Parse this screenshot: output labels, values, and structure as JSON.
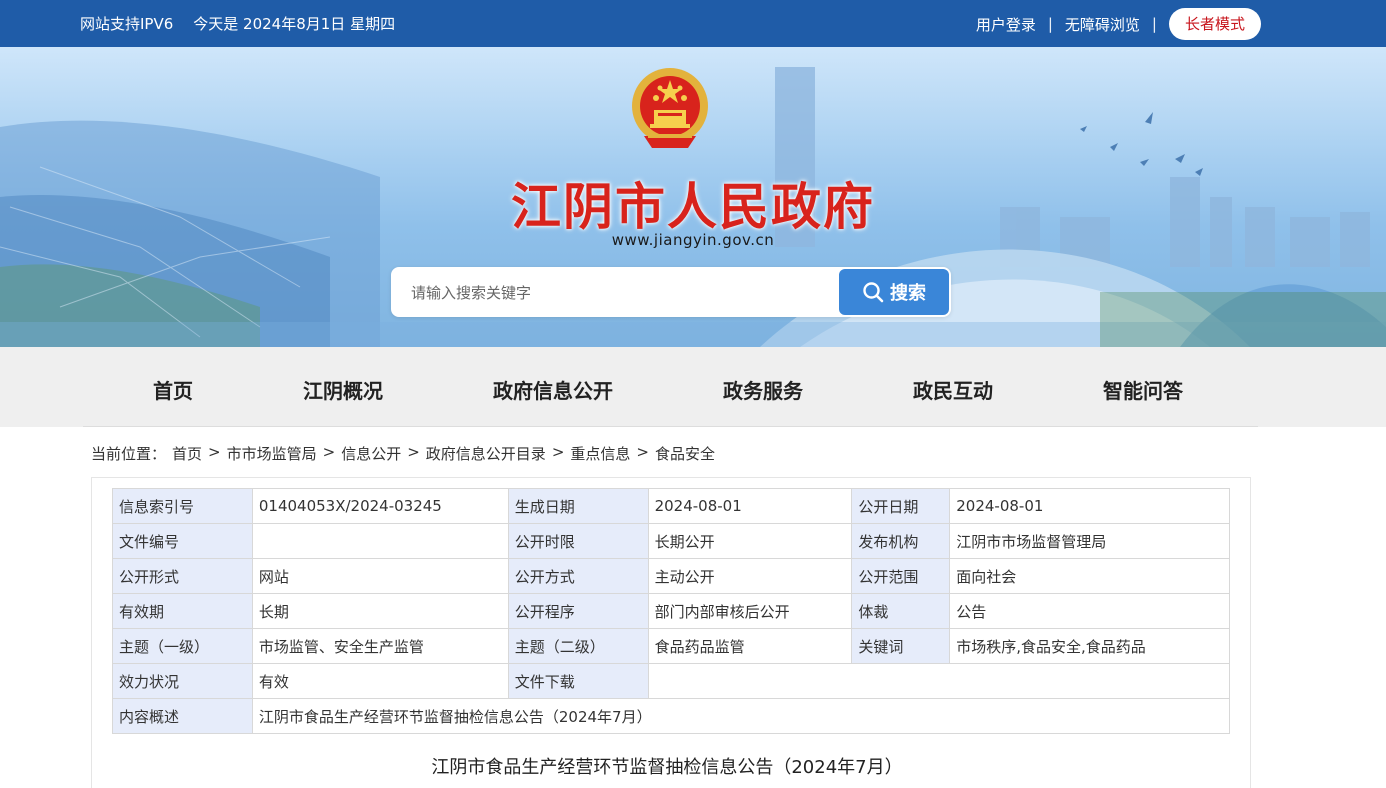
{
  "topbar": {
    "ipv6": "网站支持IPV6",
    "date": "今天是 2024年8月1日 星期四",
    "login": "用户登录",
    "sep": "|",
    "accessible": "无障碍浏览",
    "elder_mode": "长者模式"
  },
  "banner": {
    "title": "江阴市人民政府",
    "url": "www.jiangyin.gov.cn"
  },
  "search": {
    "placeholder": "请输入搜索关键字",
    "button": "搜索"
  },
  "nav": {
    "items": [
      "首页",
      "江阴概况",
      "政府信息公开",
      "政务服务",
      "政民互动",
      "智能问答"
    ]
  },
  "breadcrumb": {
    "label": "当前位置：",
    "items": [
      "首页",
      "市市场监管局",
      "信息公开",
      "政府信息公开目录",
      "重点信息",
      "食品安全"
    ],
    "sep": ">"
  },
  "meta": {
    "rows": [
      [
        "信息索引号",
        "01404053X/2024-03245",
        "生成日期",
        "2024-08-01",
        "公开日期",
        "2024-08-01"
      ],
      [
        "文件编号",
        "",
        "公开时限",
        "长期公开",
        "发布机构",
        "江阴市市场监督管理局"
      ],
      [
        "公开形式",
        "网站",
        "公开方式",
        "主动公开",
        "公开范围",
        "面向社会"
      ],
      [
        "有效期",
        "长期",
        "公开程序",
        "部门内部审核后公开",
        "体裁",
        "公告"
      ],
      [
        "主题（一级）",
        "市场监管、安全生产监管",
        "主题（二级）",
        "食品药品监管",
        "关键词",
        "市场秩序,食品安全,食品药品"
      ],
      [
        "效力状况",
        "有效",
        "文件下载",
        ""
      ],
      [
        "内容概述",
        "江阴市食品生产经营环节监督抽检信息公告（2024年7月）"
      ]
    ]
  },
  "document": {
    "title": "江阴市食品生产经营环节监督抽检信息公告（2024年7月）"
  },
  "colors": {
    "topbar": "#1f5ca8",
    "title_red": "#d8231c",
    "search_button": "#3a86d8",
    "key_cell": "#e6ecfa"
  }
}
